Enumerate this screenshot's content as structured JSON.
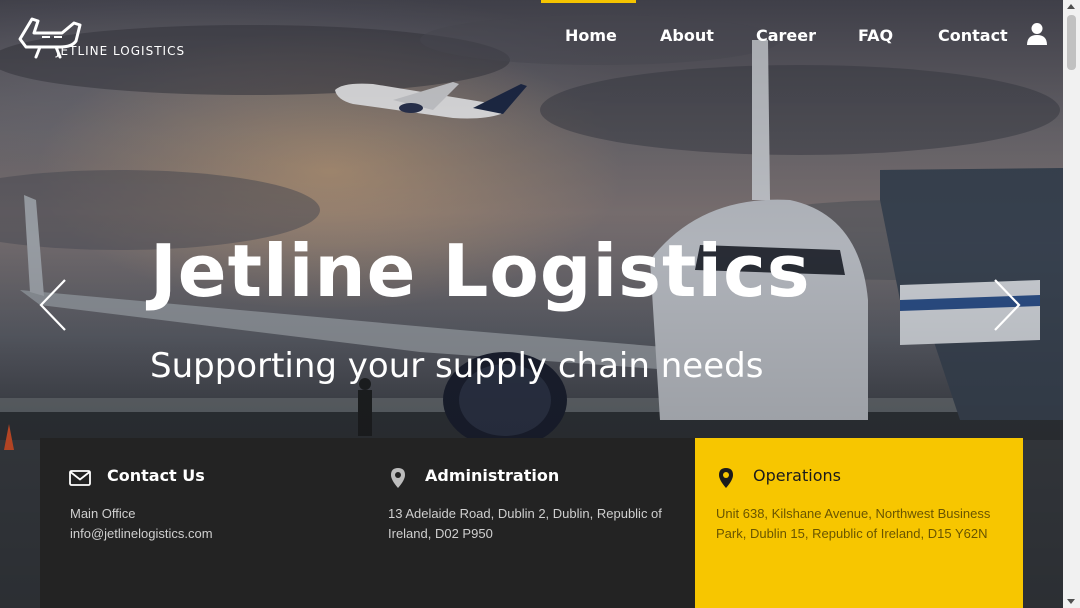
{
  "brand": {
    "name": "JETLINE LOGISTICS",
    "accent": "#f5c400"
  },
  "nav": {
    "items": [
      "Home",
      "About",
      "Career",
      "FAQ",
      "Contact"
    ],
    "active": "Home",
    "user_icon": "user-icon"
  },
  "hero": {
    "title": "Jetline Logistics",
    "subtitle": "Supporting your supply chain needs",
    "prev_icon": "chevron-left-icon",
    "next_icon": "chevron-right-icon"
  },
  "info": {
    "contact": {
      "icon": "envelope-icon",
      "heading": "Contact Us",
      "lines": [
        "Main Office",
        "info@jetlinelogistics.com"
      ]
    },
    "administration": {
      "icon": "map-pin-icon",
      "heading": "Administration",
      "text": "13 Adelaide Road, Dublin 2, Dublin, Republic of Ireland, D02 P950"
    },
    "operations": {
      "icon": "map-pin-icon",
      "heading": "Operations",
      "text": "Unit 638, Kilshane Avenue, Northwest Business Park, Dublin 15, Republic of Ireland, D15 Y62N",
      "color": "#f7c600"
    }
  }
}
